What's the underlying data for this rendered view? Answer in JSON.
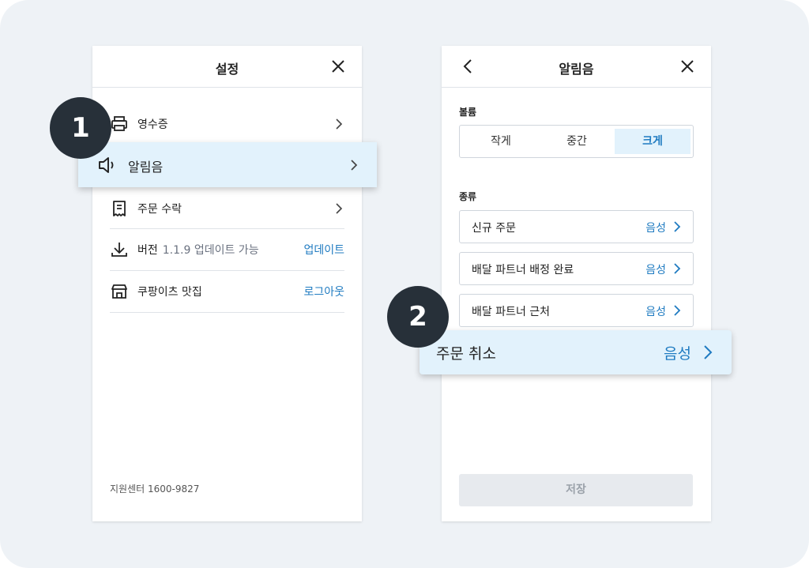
{
  "settings_panel": {
    "title": "설정",
    "items": [
      {
        "label": "영수증",
        "icon": "printer-icon"
      },
      {
        "label": "주문 수락",
        "icon": "receipt-icon"
      },
      {
        "label": "버전",
        "sublabel": "1.1.9 업데이트 가능",
        "action": "업데이트",
        "icon": "download-icon"
      },
      {
        "label": "쿠팡이츠 맛집",
        "action": "로그아웃",
        "icon": "store-icon"
      }
    ],
    "support": "지원센터 1600-9827"
  },
  "highlight_1": {
    "badge": "1",
    "label": "알림음",
    "icon": "speaker-icon"
  },
  "sound_panel": {
    "title": "알림음",
    "volume_title": "볼륨",
    "volume_options": [
      "작게",
      "중간",
      "크게"
    ],
    "volume_selected": "크게",
    "type_title": "종류",
    "types": [
      {
        "label": "신규 주문",
        "value": "음성"
      },
      {
        "label": "배달 파트너 배정 완료",
        "value": "음성"
      },
      {
        "label": "배달 파트너 근처",
        "value": "음성"
      }
    ],
    "save_label": "저장"
  },
  "highlight_2": {
    "badge": "2",
    "label": "주문 취소",
    "value": "음성"
  },
  "colors": {
    "accent": "#1f7bc1",
    "highlight_bg": "#e2f2fc",
    "badge_bg": "#273039",
    "background": "#eef2f6"
  }
}
